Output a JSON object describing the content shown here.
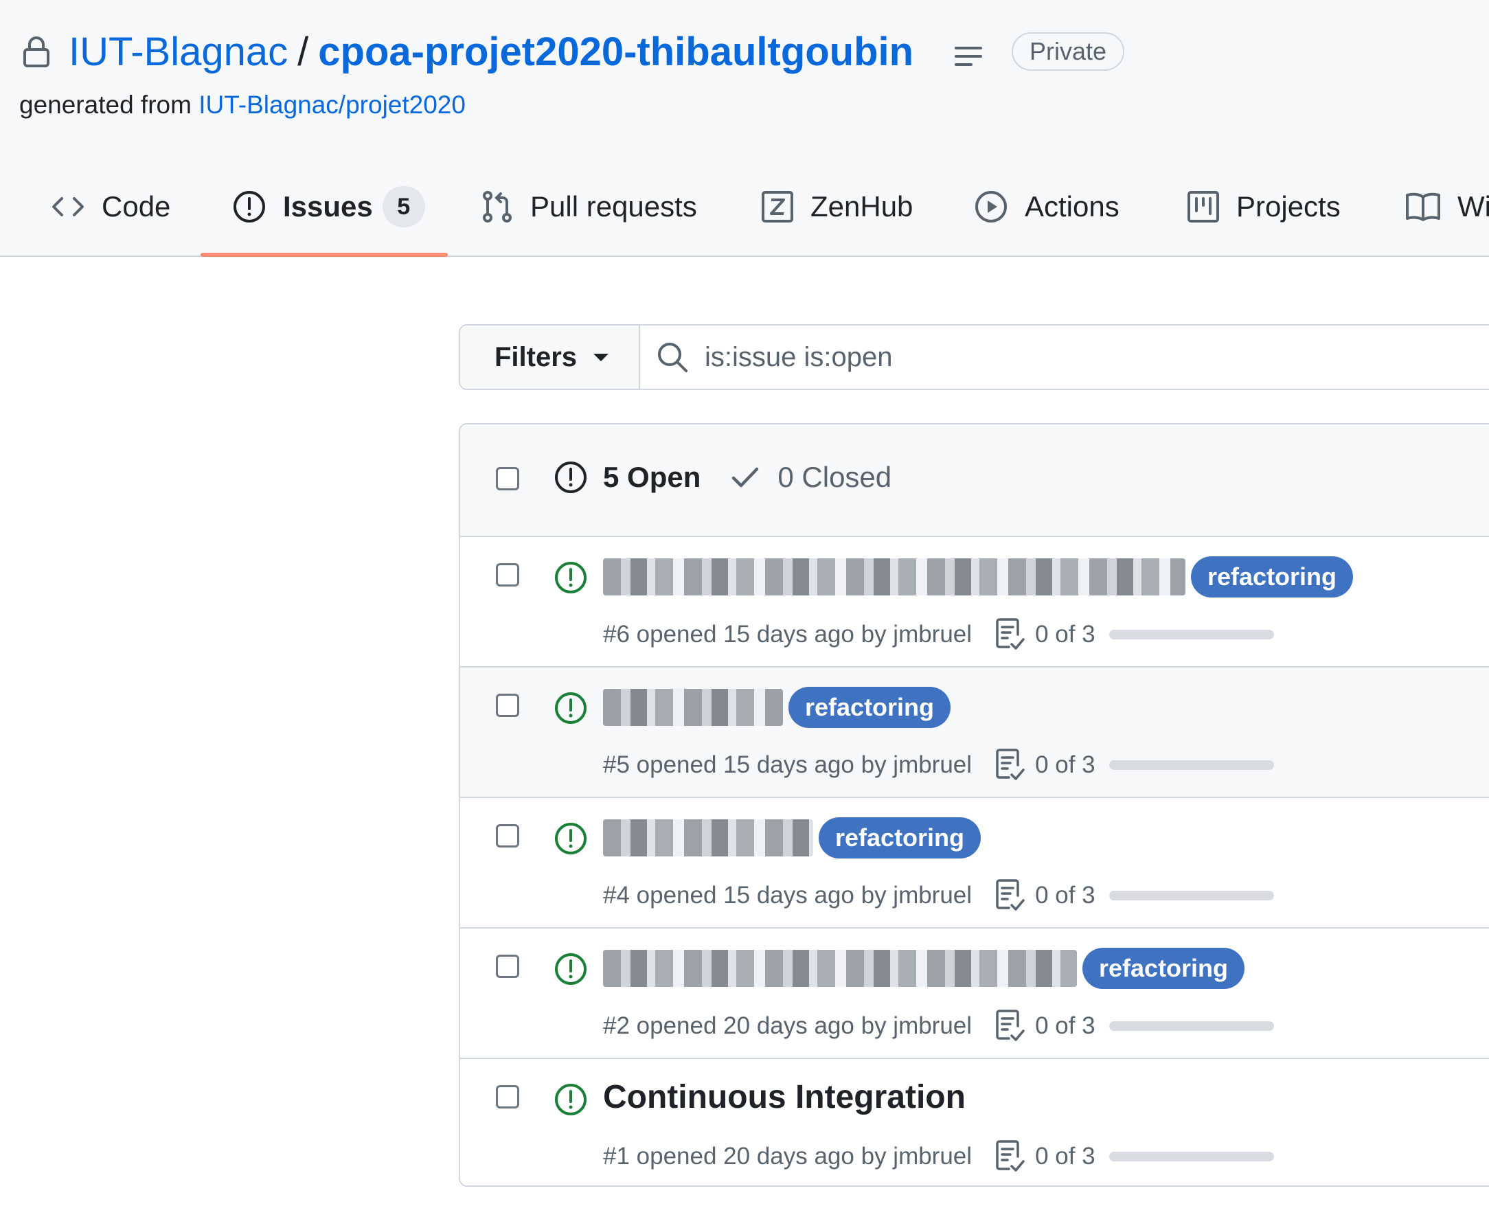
{
  "repo": {
    "owner": "IUT-Blagnac",
    "separator": "/",
    "name": "cpoa-projet2020-thibaultgoubin",
    "visibility": "Private",
    "generated_prefix": "generated from",
    "template": "IUT-Blagnac/projet2020"
  },
  "tabs": [
    {
      "label": "Code",
      "icon": "code-icon"
    },
    {
      "label": "Issues",
      "icon": "issue-opened-icon",
      "counter": "5",
      "selected": true
    },
    {
      "label": "Pull requests",
      "icon": "git-pull-request-icon"
    },
    {
      "label": "ZenHub",
      "icon": "zenhub-icon"
    },
    {
      "label": "Actions",
      "icon": "play-icon"
    },
    {
      "label": "Projects",
      "icon": "project-icon"
    },
    {
      "label": "Wi",
      "icon": "book-icon"
    }
  ],
  "filters": {
    "button_label": "Filters",
    "search_value": "is:issue is:open"
  },
  "issues_header": {
    "open_label": "5 Open",
    "closed_label": "0 Closed"
  },
  "issues": [
    {
      "number": "#6",
      "meta": "#6 opened 15 days ago by jmbruel",
      "title": "",
      "title_redacted": true,
      "label": "refactoring",
      "tasks": "0 of 3",
      "progress": 0
    },
    {
      "number": "#5",
      "meta": "#5 opened 15 days ago by jmbruel",
      "title": "",
      "title_redacted": true,
      "label": "refactoring",
      "tasks": "0 of 3",
      "progress": 0
    },
    {
      "number": "#4",
      "meta": "#4 opened 15 days ago by jmbruel",
      "title": "",
      "title_redacted": true,
      "label": "refactoring",
      "tasks": "0 of 3",
      "progress": 0
    },
    {
      "number": "#2",
      "meta": "#2 opened 20 days ago by jmbruel",
      "title": "",
      "title_redacted": true,
      "label": "refactoring",
      "tasks": "0 of 3",
      "progress": 0
    },
    {
      "number": "#1",
      "meta": "#1 opened 20 days ago by jmbruel",
      "title": "Continuous Integration",
      "title_redacted": false,
      "label": "",
      "tasks": "0 of 3",
      "progress": 0
    }
  ],
  "colors": {
    "link": "#0969da",
    "open_issue": "#1a7f37",
    "label_bg": "#3f72c0",
    "tab_underline": "#fd8c73"
  }
}
